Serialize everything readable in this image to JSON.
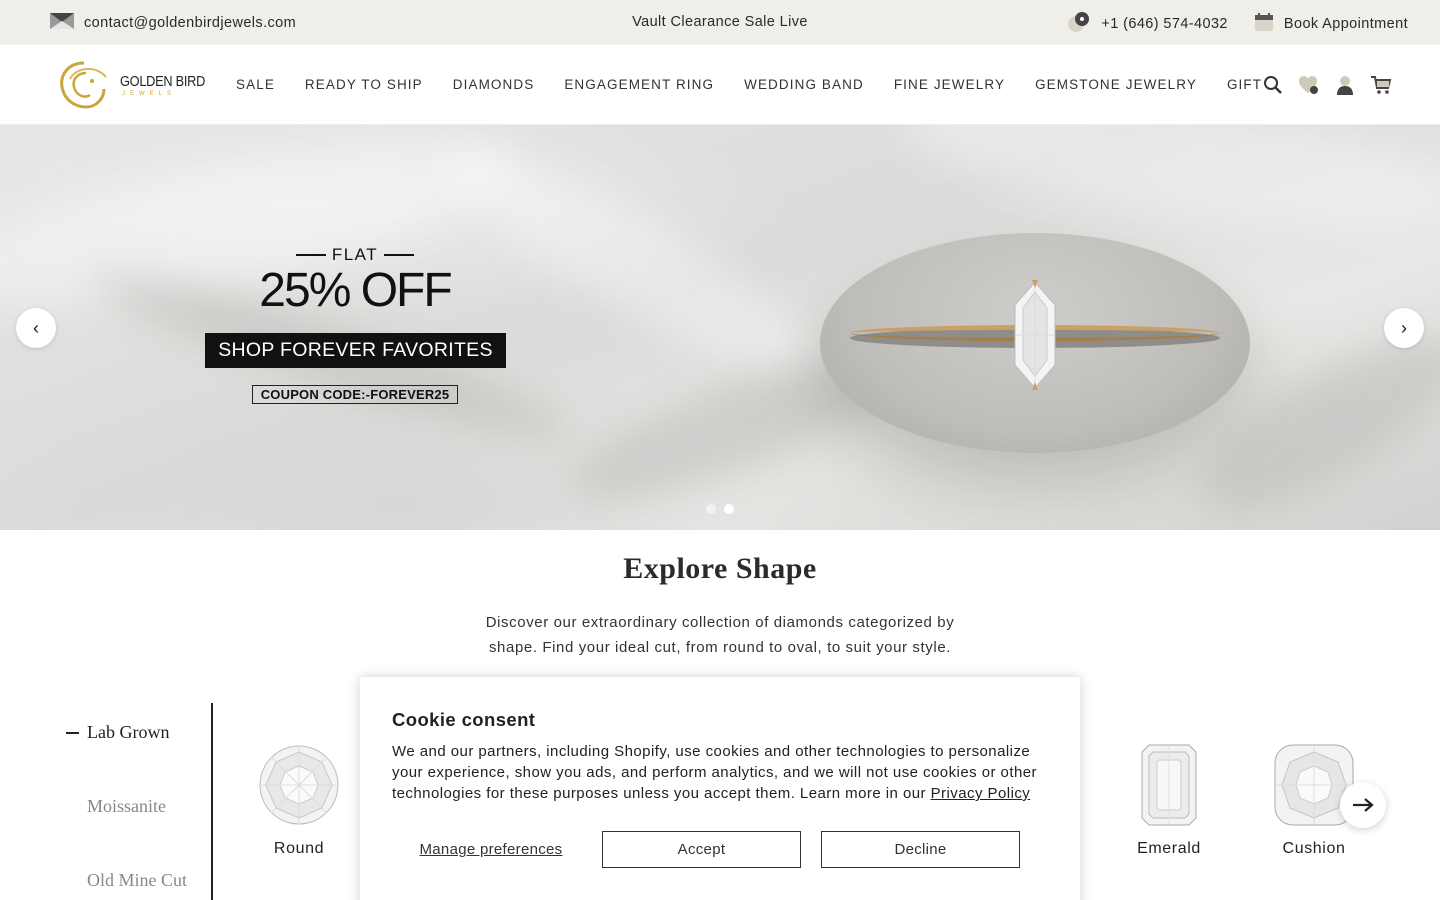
{
  "topbar": {
    "email": "contact@goldenbirdjewels.com",
    "announcement": "Vault Clearance Sale Live",
    "phone": "+1 (646) 574-4032",
    "appointment": "Book Appointment"
  },
  "header": {
    "logo_text": "GOLDEN BIRD",
    "logo_subtext": "JEWELS",
    "nav": [
      "SALE",
      "READY TO SHIP",
      "DIAMONDS",
      "ENGAGEMENT RING",
      "WEDDING BAND",
      "FINE JEWELRY",
      "GEMSTONE JEWELRY",
      "GIFT"
    ],
    "icons": [
      "search-icon",
      "wishlist-icon",
      "account-icon",
      "cart-icon"
    ]
  },
  "hero": {
    "flat": "FLAT",
    "discount": "25% OFF",
    "cta": "SHOP FOREVER FAVORITES",
    "coupon": "COUPON CODE:-FOREVER25",
    "prev": "‹",
    "next": "›",
    "slides_total": 2,
    "active_slide": 2
  },
  "explore": {
    "title": "Explore Shape",
    "description": "Discover our extraordinary collection of diamonds categorized by shape. Find your ideal cut, from round to oval, to suit your style.",
    "tabs": [
      "Lab Grown",
      "Moissanite",
      "Old Mine Cut"
    ],
    "active_tab": "Lab Grown",
    "shapes_visible": [
      "Round",
      "Emerald",
      "Cushion"
    ]
  },
  "cookie": {
    "title": "Cookie consent",
    "body": "We and our partners, including Shopify, use cookies and other technologies to personalize your experience, show you ads, and perform analytics, and we will not use cookies or other technologies for these purposes unless you accept them. Learn more in our ",
    "policy_link": "Privacy Policy",
    "manage": "Manage preferences",
    "accept": "Accept",
    "decline": "Decline"
  },
  "colors": {
    "topbar_bg": "#efeee9",
    "gold": "#c9a63a",
    "dark": "#111111"
  }
}
